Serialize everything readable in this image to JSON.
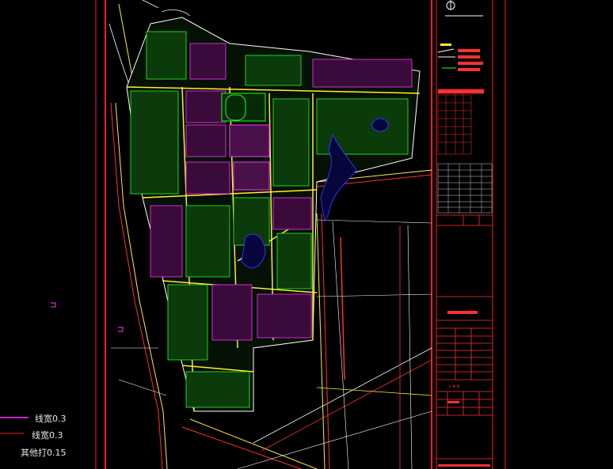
{
  "legend": {
    "items": [
      {
        "label": "线宽0.3",
        "color": "#ff33ff"
      },
      {
        "label": "线宽0.3",
        "color": "#ff2020"
      },
      {
        "label": "其他打0.15",
        "color": "#ffffff"
      }
    ]
  },
  "title_block": {
    "stamp_label": "分 单 图"
  },
  "colors": {
    "background": "#000000",
    "frame": "#ff2020",
    "road": "#ffee33",
    "green": "#22ff22",
    "magenta": "#ff33ff",
    "water": "#2222ff",
    "table_grid": "#cccccc"
  }
}
